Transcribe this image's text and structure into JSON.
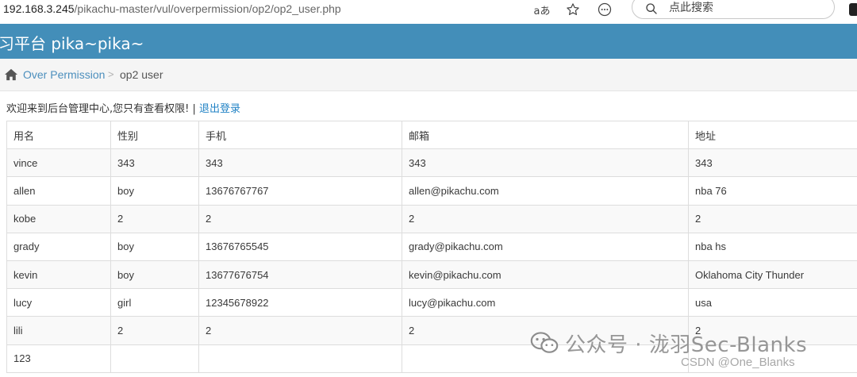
{
  "browser": {
    "url_host": "192.168.3.245",
    "url_path": "/pikachu-master/vul/overpermission/op2/op2_user.php",
    "search_placeholder": "点此搜索"
  },
  "header": {
    "title": "习平台 pika~pika~",
    "bg_color": "#438eb9"
  },
  "breadcrumb": {
    "parent": "Over Permission",
    "separator": ">",
    "current": "op2 user"
  },
  "welcome": {
    "text": "欢迎来到后台管理中心,您只有查看权限! | ",
    "logout": "退出登录"
  },
  "table": {
    "headers": [
      "用名",
      "性别",
      "手机",
      "邮箱",
      "地址"
    ],
    "rows": [
      [
        "vince",
        "343",
        "343",
        "343",
        "343"
      ],
      [
        "allen",
        "boy",
        "13676767767",
        "allen@pikachu.com",
        "nba 76"
      ],
      [
        "kobe",
        "2",
        "2",
        "2",
        "2"
      ],
      [
        "grady",
        "boy",
        "13676765545",
        "grady@pikachu.com",
        "nba hs"
      ],
      [
        "kevin",
        "boy",
        "13677676754",
        "kevin@pikachu.com",
        "Oklahoma City Thunder"
      ],
      [
        "lucy",
        "girl",
        "12345678922",
        "lucy@pikachu.com",
        "usa"
      ],
      [
        "lili",
        "2",
        "2",
        "2",
        "2"
      ],
      [
        "123",
        "",
        "",
        "",
        ""
      ]
    ]
  },
  "watermark": {
    "text": "公众号 · 泷羽Sec-Blanks",
    "csdn": "CSDN @One_Blanks"
  }
}
